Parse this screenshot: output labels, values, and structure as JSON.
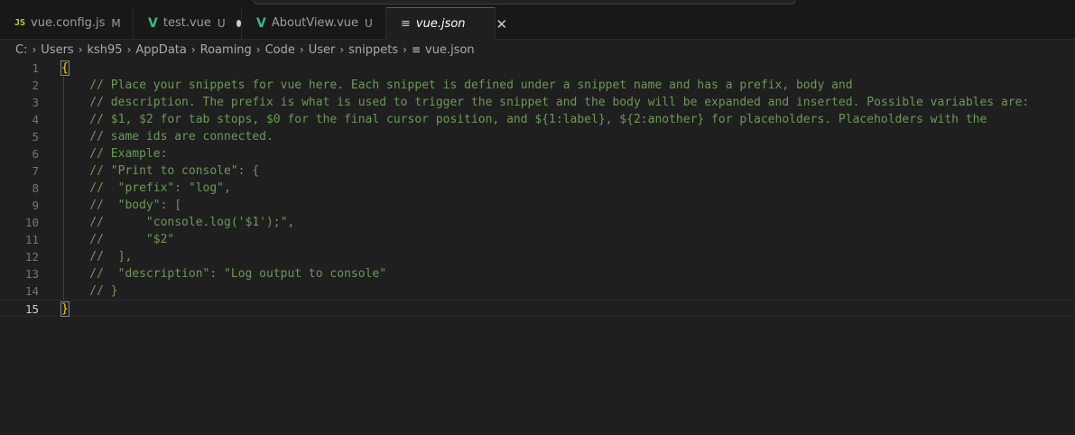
{
  "tabs": [
    {
      "icon": "JS",
      "label": "vue.config.js",
      "status": "M",
      "active": false
    },
    {
      "icon": "V",
      "label": "test.vue",
      "status": "U",
      "dirty": true,
      "active": false
    },
    {
      "icon": "V",
      "label": "AboutView.vue",
      "status": "U",
      "active": false
    },
    {
      "icon": "≡",
      "label": "vue.json",
      "active": true,
      "close": "✕"
    }
  ],
  "breadcrumb": [
    "C:",
    "Users",
    "ksh95",
    "AppData",
    "Roaming",
    "Code",
    "User",
    "snippets",
    "vue.json"
  ],
  "breadcrumb_sep": "›",
  "editor": {
    "current_line": 15,
    "lines": [
      {
        "num": "1",
        "text": "{"
      },
      {
        "num": "2",
        "text": "    // Place your snippets for vue here. Each snippet is defined under a snippet name and has a prefix, body and"
      },
      {
        "num": "3",
        "text": "    // description. The prefix is what is used to trigger the snippet and the body will be expanded and inserted. Possible variables are:"
      },
      {
        "num": "4",
        "text": "    // $1, $2 for tab stops, $0 for the final cursor position, and ${1:label}, ${2:another} for placeholders. Placeholders with the"
      },
      {
        "num": "5",
        "text": "    // same ids are connected."
      },
      {
        "num": "6",
        "text": "    // Example:"
      },
      {
        "num": "7",
        "text": "    // \"Print to console\": {"
      },
      {
        "num": "8",
        "text": "    //  \"prefix\": \"log\","
      },
      {
        "num": "9",
        "text": "    //  \"body\": ["
      },
      {
        "num": "10",
        "text": "    //      \"console.log('$1');\","
      },
      {
        "num": "11",
        "text": "    //      \"$2\""
      },
      {
        "num": "12",
        "text": "    //  ],"
      },
      {
        "num": "13",
        "text": "    //  \"description\": \"Log output to console\""
      },
      {
        "num": "14",
        "text": "    // }"
      },
      {
        "num": "15",
        "text": "}"
      }
    ]
  }
}
